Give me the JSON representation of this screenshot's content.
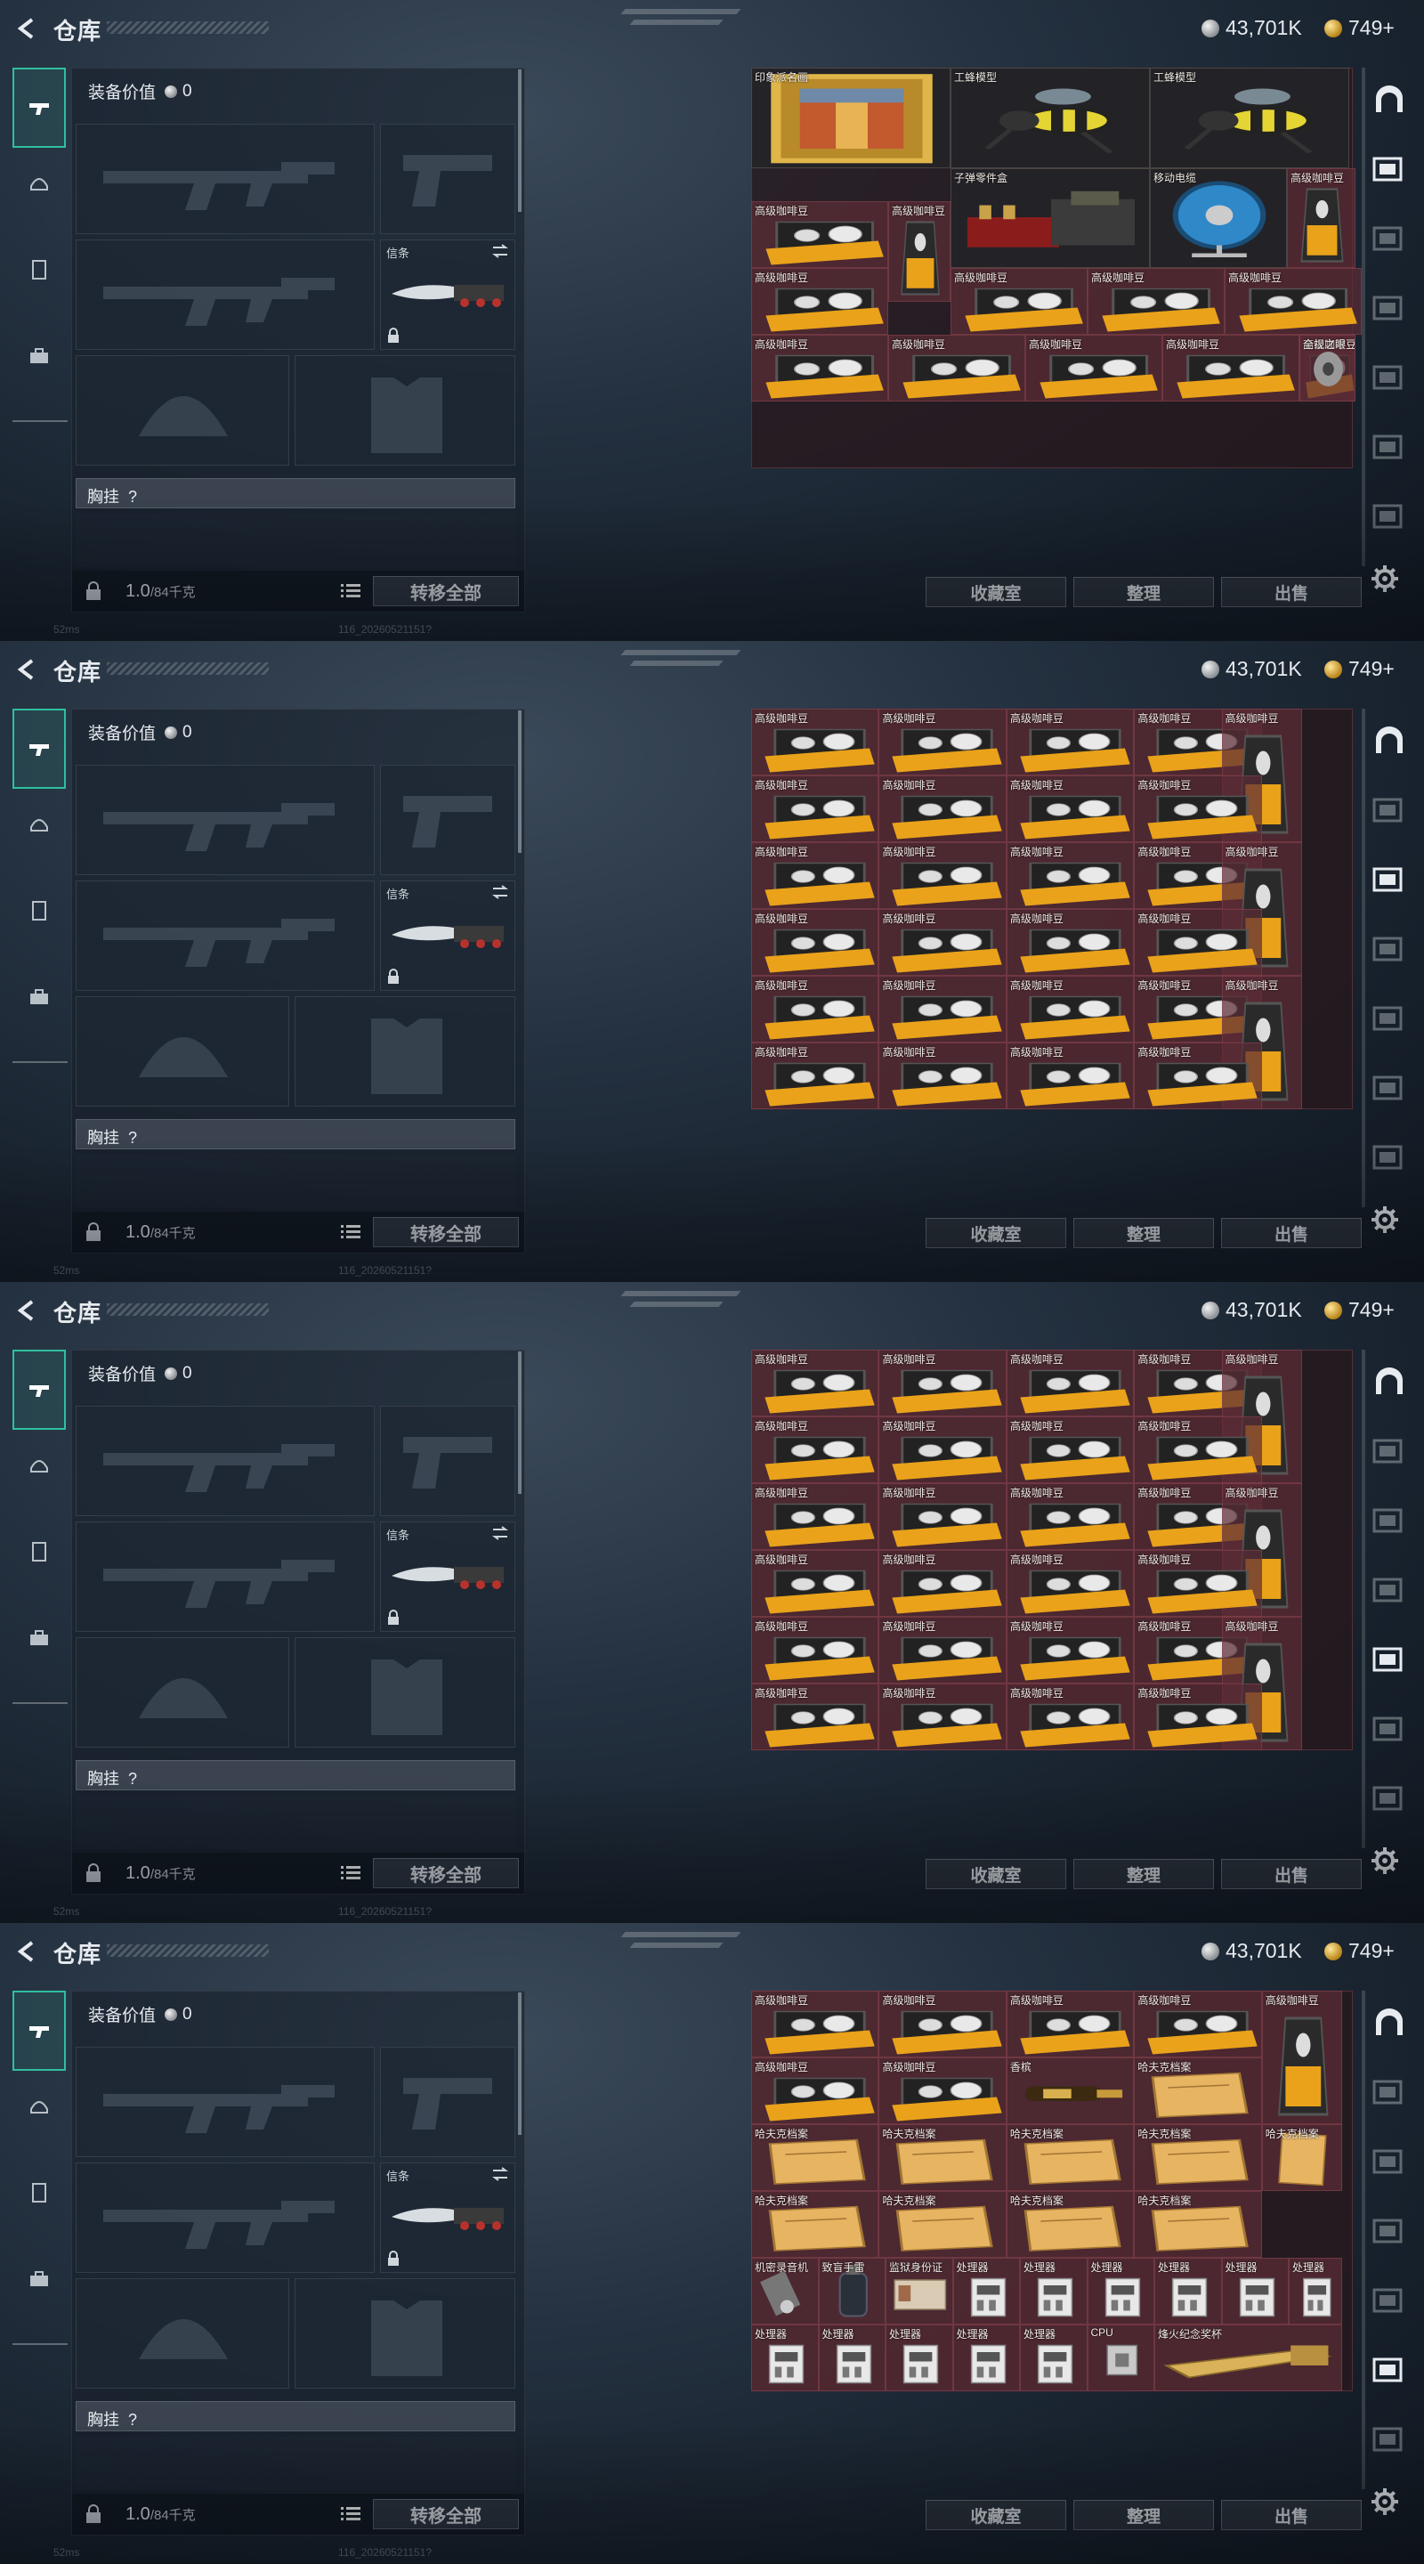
{
  "header": {
    "title": "仓库",
    "currency_1": "43,701K",
    "currency_2": "749+"
  },
  "loadout": {
    "equip_value_label": "装备价值",
    "equip_value": "0",
    "melee_slot_label": "信条",
    "chest_label": "胸挂",
    "chest_help": "?",
    "weight": "1.0",
    "weight_capacity": "/84千克",
    "transfer_all_label": "转移全部"
  },
  "actions": {
    "collection_room": "收藏室",
    "organize": "整理",
    "sell": "出售"
  },
  "footer": {
    "ping": "52ms",
    "build": "116_20260521151?"
  },
  "colors": {
    "accent": "#2ec0a0",
    "grid_cell": "#5c2c36"
  },
  "screens": [
    {
      "grid_height_rows": 6,
      "items": [
        {
          "name": "印象派名画",
          "type": "painting"
        },
        {
          "name": "工蜂模型",
          "type": "bee"
        },
        {
          "name": "工蜂模型",
          "type": "bee"
        },
        {
          "name": "子弹零件盒",
          "type": "ammo"
        },
        {
          "name": "移动电缆",
          "type": "cable"
        },
        {
          "name": "高级咖啡豆",
          "type": "bag"
        },
        {
          "name": "高级咖啡豆",
          "type": "box"
        },
        {
          "name": "高级咖啡豆",
          "type": "bag"
        },
        {
          "name": "高级咖啡豆",
          "type": "box"
        },
        {
          "name": "高级咖啡豆",
          "type": "box"
        },
        {
          "name": "高级咖啡豆",
          "type": "box"
        },
        {
          "name": "高级咖啡豆",
          "type": "box"
        },
        {
          "name": "高级咖啡豆",
          "type": "box"
        },
        {
          "name": "高级咖啡豆",
          "type": "box"
        },
        {
          "name": "高级咖啡豆",
          "type": "box"
        },
        {
          "name": "高级咖啡豆",
          "type": "box"
        },
        {
          "name": "高级咖啡豆",
          "type": "box"
        },
        {
          "name": "全视之眼",
          "type": "eye"
        }
      ]
    },
    {
      "grid_height_rows": 6,
      "items": [
        {
          "name": "高级咖啡豆",
          "type": "box"
        },
        {
          "name": "高级咖啡豆",
          "type": "box"
        },
        {
          "name": "高级咖啡豆",
          "type": "box"
        },
        {
          "name": "高级咖啡豆",
          "type": "box"
        },
        {
          "name": "高级咖啡豆",
          "type": "bag"
        },
        {
          "name": "高级咖啡豆",
          "type": "box"
        },
        {
          "name": "高级咖啡豆",
          "type": "box"
        },
        {
          "name": "高级咖啡豆",
          "type": "box"
        },
        {
          "name": "高级咖啡豆",
          "type": "box"
        },
        {
          "name": "高级咖啡豆",
          "type": "box"
        },
        {
          "name": "高级咖啡豆",
          "type": "box"
        },
        {
          "name": "高级咖啡豆",
          "type": "box"
        },
        {
          "name": "高级咖啡豆",
          "type": "box"
        },
        {
          "name": "高级咖啡豆",
          "type": "bag"
        },
        {
          "name": "高级咖啡豆",
          "type": "box"
        },
        {
          "name": "高级咖啡豆",
          "type": "box"
        },
        {
          "name": "高级咖啡豆",
          "type": "box"
        },
        {
          "name": "高级咖啡豆",
          "type": "box"
        },
        {
          "name": "高级咖啡豆",
          "type": "box"
        },
        {
          "name": "高级咖啡豆",
          "type": "box"
        },
        {
          "name": "高级咖啡豆",
          "type": "box"
        },
        {
          "name": "高级咖啡豆",
          "type": "box"
        },
        {
          "name": "高级咖啡豆",
          "type": "bag"
        },
        {
          "name": "高级咖啡豆",
          "type": "box"
        },
        {
          "name": "高级咖啡豆",
          "type": "box"
        },
        {
          "name": "高级咖啡豆",
          "type": "box"
        },
        {
          "name": "高级咖啡豆",
          "type": "box"
        }
      ]
    },
    {
      "grid_height_rows": 6,
      "items": [
        {
          "name": "高级咖啡豆",
          "type": "box"
        },
        {
          "name": "高级咖啡豆",
          "type": "box"
        },
        {
          "name": "高级咖啡豆",
          "type": "box"
        },
        {
          "name": "高级咖啡豆",
          "type": "box"
        },
        {
          "name": "高级咖啡豆",
          "type": "bag"
        },
        {
          "name": "高级咖啡豆",
          "type": "box"
        },
        {
          "name": "高级咖啡豆",
          "type": "box"
        },
        {
          "name": "高级咖啡豆",
          "type": "box"
        },
        {
          "name": "高级咖啡豆",
          "type": "box"
        },
        {
          "name": "高级咖啡豆",
          "type": "box"
        },
        {
          "name": "高级咖啡豆",
          "type": "box"
        },
        {
          "name": "高级咖啡豆",
          "type": "box"
        },
        {
          "name": "高级咖啡豆",
          "type": "box"
        },
        {
          "name": "高级咖啡豆",
          "type": "bag"
        },
        {
          "name": "高级咖啡豆",
          "type": "box"
        },
        {
          "name": "高级咖啡豆",
          "type": "box"
        },
        {
          "name": "高级咖啡豆",
          "type": "box"
        },
        {
          "name": "高级咖啡豆",
          "type": "box"
        },
        {
          "name": "高级咖啡豆",
          "type": "box"
        },
        {
          "name": "高级咖啡豆",
          "type": "box"
        },
        {
          "name": "高级咖啡豆",
          "type": "box"
        },
        {
          "name": "高级咖啡豆",
          "type": "box"
        },
        {
          "name": "高级咖啡豆",
          "type": "bag"
        },
        {
          "name": "高级咖啡豆",
          "type": "box"
        },
        {
          "name": "高级咖啡豆",
          "type": "box"
        },
        {
          "name": "高级咖啡豆",
          "type": "box"
        },
        {
          "name": "高级咖啡豆",
          "type": "box"
        }
      ]
    },
    {
      "grid_height_rows": 6,
      "items": [
        {
          "name": "高级咖啡豆",
          "type": "box"
        },
        {
          "name": "高级咖啡豆",
          "type": "box"
        },
        {
          "name": "高级咖啡豆",
          "type": "box"
        },
        {
          "name": "高级咖啡豆",
          "type": "box"
        },
        {
          "name": "高级咖啡豆",
          "type": "bag"
        },
        {
          "name": "高级咖啡豆",
          "type": "box"
        },
        {
          "name": "高级咖啡豆",
          "type": "box"
        },
        {
          "name": "香槟",
          "type": "bottle"
        },
        {
          "name": "哈夫克档案",
          "type": "file"
        },
        {
          "name": "哈夫克档案",
          "type": "file"
        },
        {
          "name": "哈夫克档案",
          "type": "file"
        },
        {
          "name": "哈夫克档案",
          "type": "file"
        },
        {
          "name": "哈夫克档案",
          "type": "file"
        },
        {
          "name": "哈夫克档案",
          "type": "filev"
        },
        {
          "name": "哈夫克档案",
          "type": "file"
        },
        {
          "name": "哈夫克档案",
          "type": "file"
        },
        {
          "name": "哈夫克档案",
          "type": "file"
        },
        {
          "name": "哈夫克档案",
          "type": "file"
        },
        {
          "name": "机密录音机",
          "type": "recorder"
        },
        {
          "name": "致盲手雷",
          "type": "grenade"
        },
        {
          "name": "监狱身份证",
          "type": "card"
        },
        {
          "name": "处理器",
          "type": "cpu"
        },
        {
          "name": "处理器",
          "type": "cpu"
        },
        {
          "name": "处理器",
          "type": "cpu"
        },
        {
          "name": "处理器",
          "type": "cpu"
        },
        {
          "name": "处理器",
          "type": "cpu"
        },
        {
          "name": "处理器",
          "type": "cpu"
        },
        {
          "name": "处理器",
          "type": "cpu"
        },
        {
          "name": "处理器",
          "type": "cpu"
        },
        {
          "name": "处理器",
          "type": "cpu"
        },
        {
          "name": "处理器",
          "type": "cpu"
        },
        {
          "name": "处理器",
          "type": "cpu"
        },
        {
          "name": "CPU",
          "type": "chip"
        },
        {
          "name": "烽火纪念奖杯",
          "type": "trophy"
        }
      ]
    }
  ]
}
